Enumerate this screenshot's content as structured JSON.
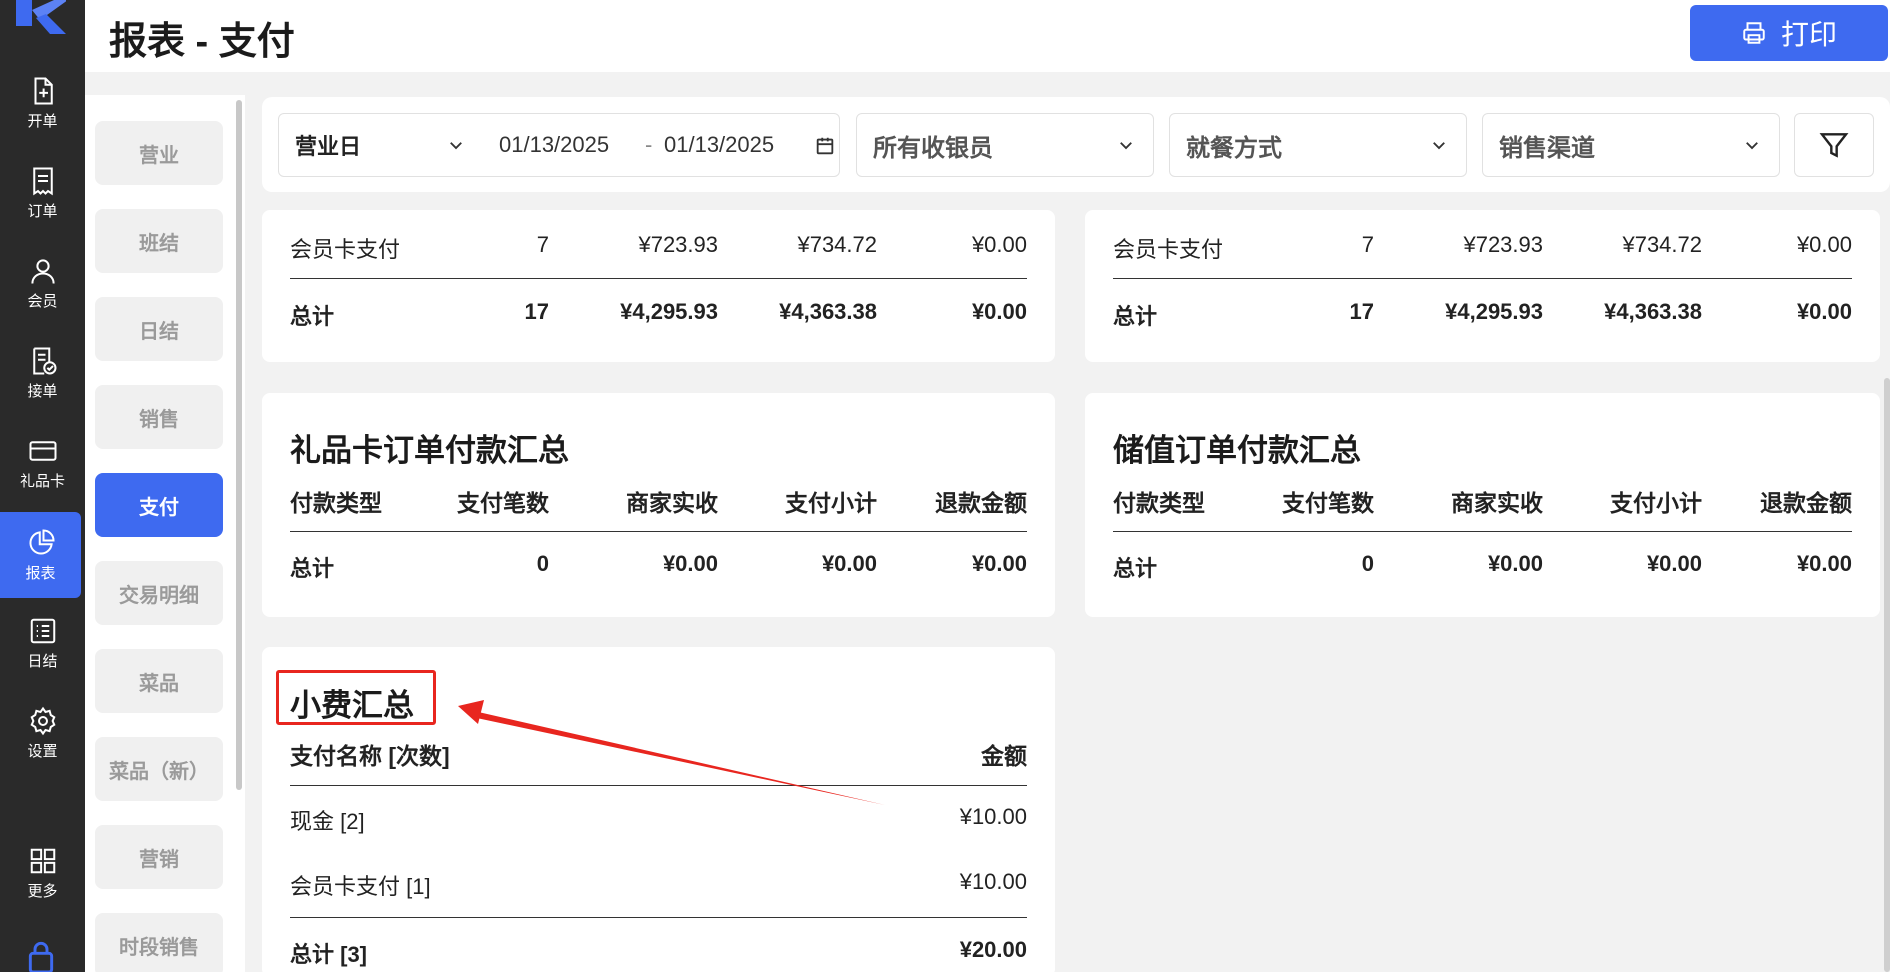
{
  "header": {
    "title": "报表 - 支付",
    "print_label": "打印"
  },
  "nav": [
    {
      "label": "开单",
      "icon": "file-plus-icon"
    },
    {
      "label": "订单",
      "icon": "receipt-icon"
    },
    {
      "label": "会员",
      "icon": "user-icon"
    },
    {
      "label": "接单",
      "icon": "order-check-icon"
    },
    {
      "label": "礼品卡",
      "icon": "card-icon"
    },
    {
      "label": "报表",
      "icon": "pie-chart-icon"
    },
    {
      "label": "日结",
      "icon": "list-icon"
    },
    {
      "label": "设置",
      "icon": "gear-icon"
    },
    {
      "label": "更多",
      "icon": "grid-icon"
    }
  ],
  "subnav": [
    "营业",
    "班结",
    "日结",
    "销售",
    "支付",
    "交易明细",
    "菜品",
    "菜品（新）",
    "营销",
    "时段销售"
  ],
  "filters": {
    "date_type": "营业日",
    "date_from": "01/13/2025",
    "date_sep": "-",
    "date_to": "01/13/2025",
    "cashier": "所有收银员",
    "dining": "就餐方式",
    "channel": "销售渠道"
  },
  "top_left": {
    "row": [
      "会员卡支付",
      "7",
      "¥723.93",
      "¥734.72",
      "¥0.00"
    ],
    "total": [
      "总计",
      "17",
      "¥4,295.93",
      "¥4,363.38",
      "¥0.00"
    ]
  },
  "top_right": {
    "row": [
      "会员卡支付",
      "7",
      "¥723.93",
      "¥734.72",
      "¥0.00"
    ],
    "total": [
      "总计",
      "17",
      "¥4,295.93",
      "¥4,363.38",
      "¥0.00"
    ]
  },
  "giftcard": {
    "title": "礼品卡订单付款汇总",
    "headers": [
      "付款类型",
      "支付笔数",
      "商家实收",
      "支付小计",
      "退款金额"
    ],
    "total": [
      "总计",
      "0",
      "¥0.00",
      "¥0.00",
      "¥0.00"
    ]
  },
  "stored": {
    "title": "储值订单付款汇总",
    "headers": [
      "付款类型",
      "支付笔数",
      "商家实收",
      "支付小计",
      "退款金额"
    ],
    "total": [
      "总计",
      "0",
      "¥0.00",
      "¥0.00",
      "¥0.00"
    ]
  },
  "tips": {
    "title": "小费汇总",
    "headers": [
      "支付名称 [次数]",
      "金额"
    ],
    "rows": [
      [
        "现金 [2]",
        "¥10.00"
      ],
      [
        "会员卡支付 [1]",
        "¥10.00"
      ]
    ],
    "total": [
      "总计 [3]",
      "¥20.00"
    ]
  },
  "colors": {
    "accent": "#3e6af0",
    "annotation": "#e8261f"
  }
}
